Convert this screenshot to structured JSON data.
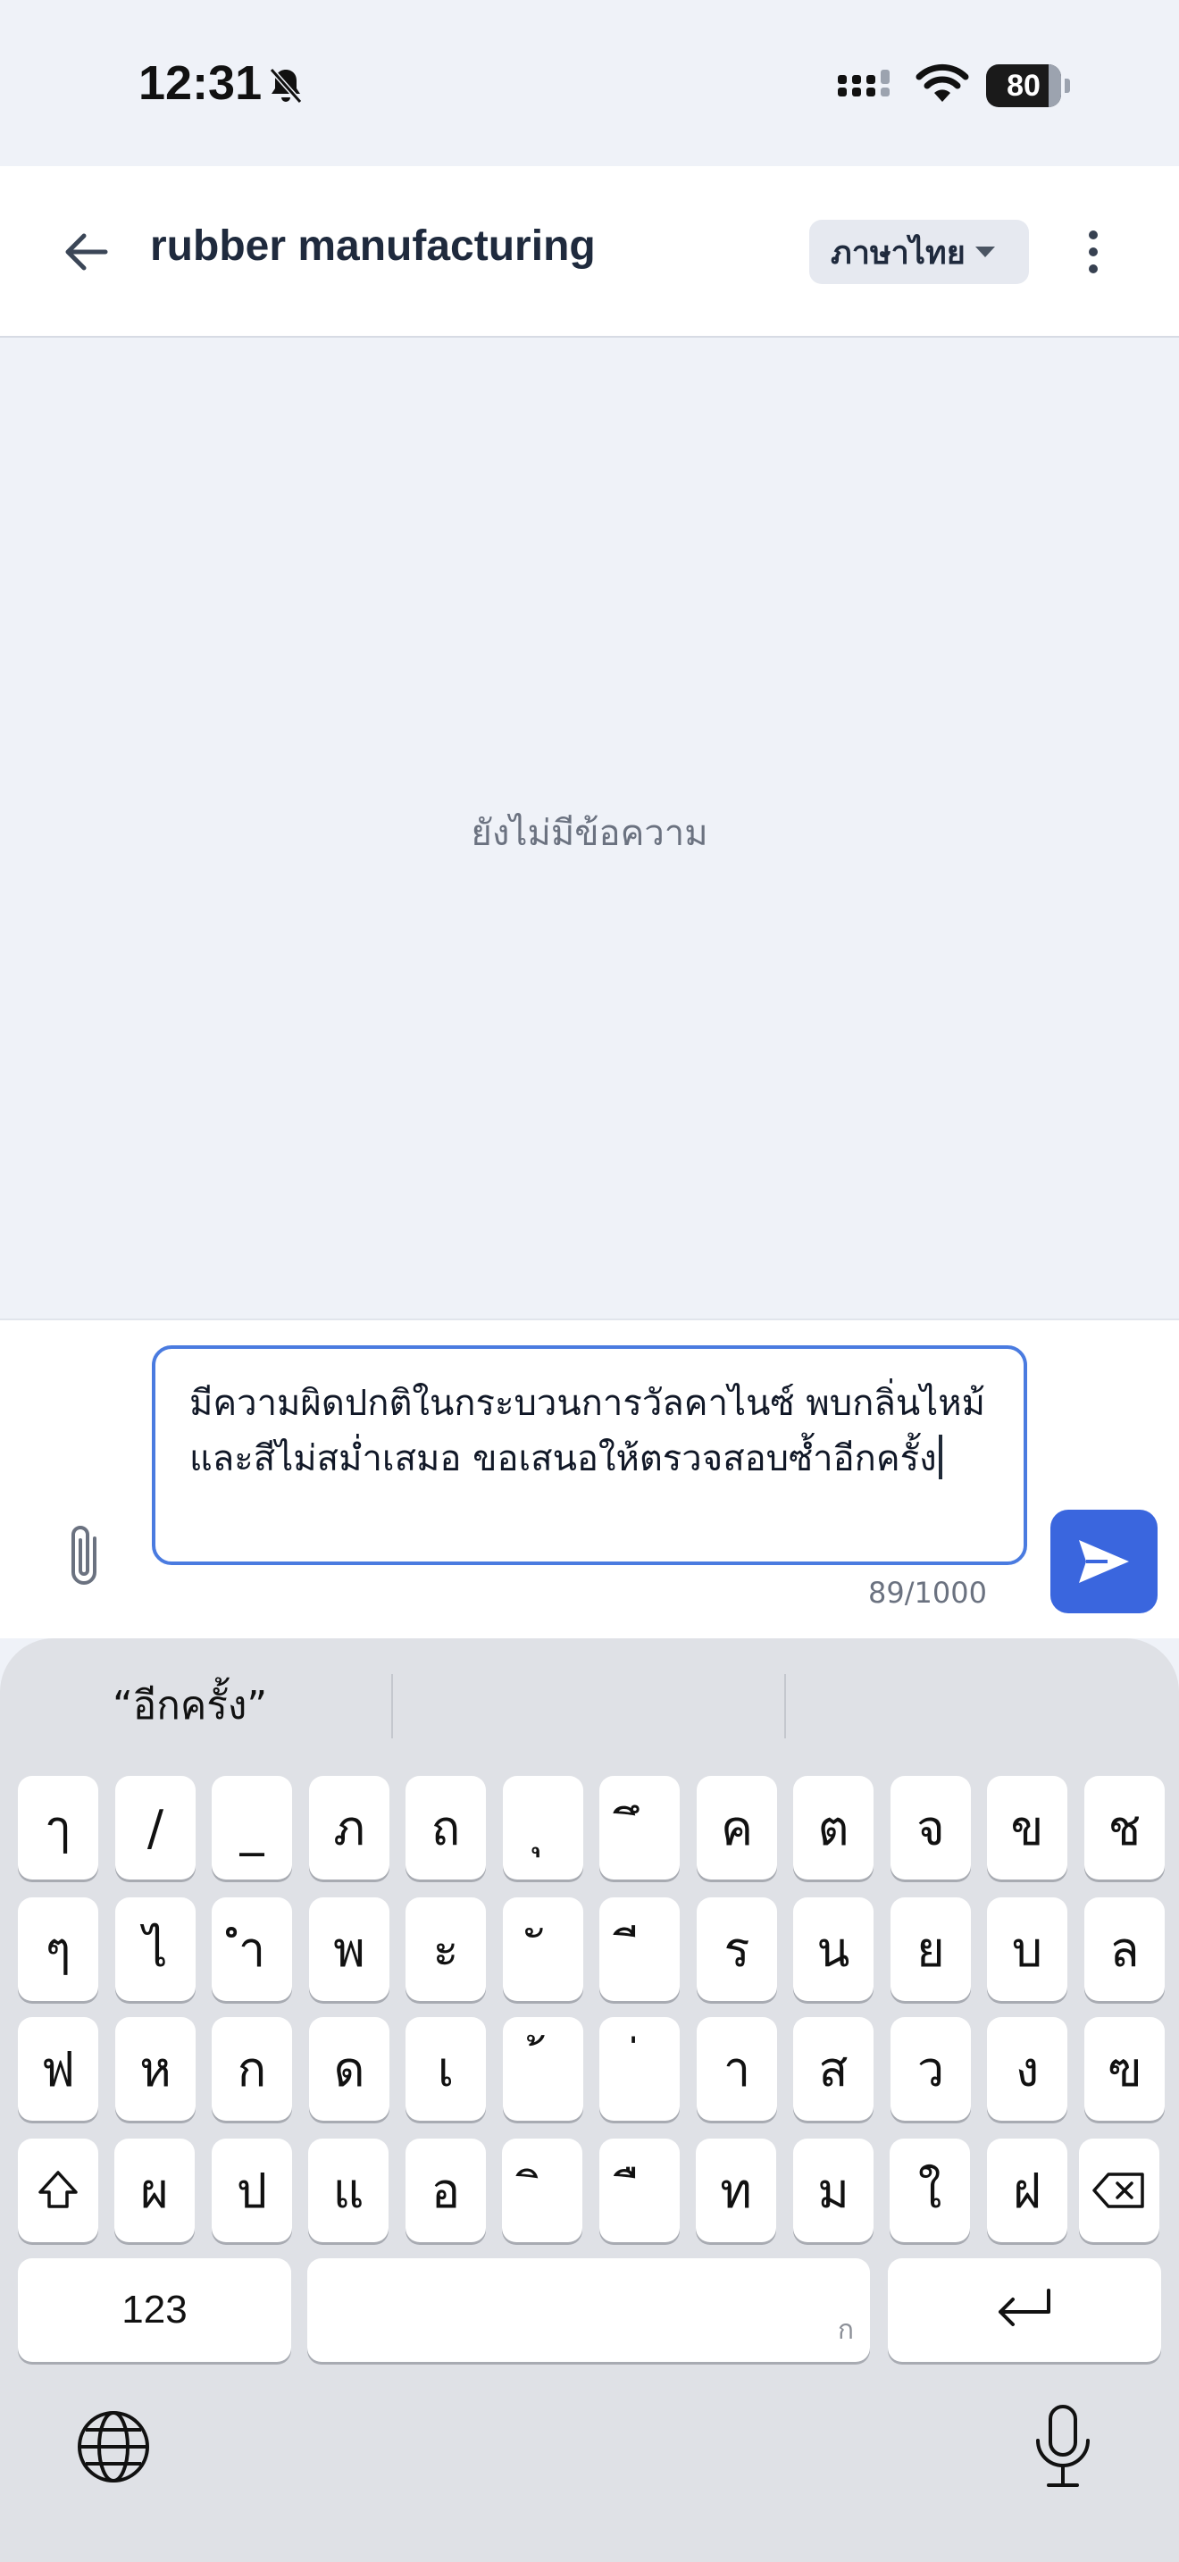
{
  "status_bar": {
    "time": "12:31",
    "battery": "80",
    "icons": [
      "bell-slash-icon",
      "signal-icon",
      "wifi-icon",
      "battery-icon"
    ]
  },
  "header": {
    "title": "rubber manufacturing",
    "language": "ภาษาไทย",
    "icons": [
      "back-arrow-icon",
      "chevron-down-icon",
      "more-vertical-icon"
    ]
  },
  "messages": {
    "empty_text": "ยังไม่มีข้อความ"
  },
  "composer": {
    "input_value": "มีความผิดปกติในกระบวนการวัลคาไนซ์ พบกลิ่นไหม้และสีไม่สม่ำเสมอ ขอเสนอให้ตรวจสอบซ้ำอีกครั้ง",
    "char_count": "89/1000",
    "icons": [
      "paperclip-icon",
      "send-icon"
    ],
    "accent_color": "#3a66de"
  },
  "keyboard": {
    "suggestions": [
      "“อีกครั้ง”",
      "",
      ""
    ],
    "row1": [
      "ๅ",
      "/",
      "_",
      "ภ",
      "ถ",
      "ุ",
      "ึ",
      "ค",
      "ต",
      "จ",
      "ข",
      "ช"
    ],
    "row2": [
      "ๆ",
      "ไ",
      "ำ",
      "พ",
      "ะ",
      "ั",
      "ี",
      "ร",
      "น",
      "ย",
      "บ",
      "ล"
    ],
    "row3": [
      "ฟ",
      "ห",
      "ก",
      "ด",
      "เ",
      "้",
      "่",
      "า",
      "ส",
      "ว",
      "ง",
      "ฃ"
    ],
    "row4": [
      "ผ",
      "ป",
      "แ",
      "อ",
      "ิ",
      "ื",
      "ท",
      "ม",
      "ใ",
      "ฝ"
    ],
    "numbers_key": "123",
    "space_hint": "ก",
    "icons": [
      "shift-icon",
      "backspace-icon",
      "return-icon",
      "globe-icon",
      "microphone-icon"
    ]
  }
}
